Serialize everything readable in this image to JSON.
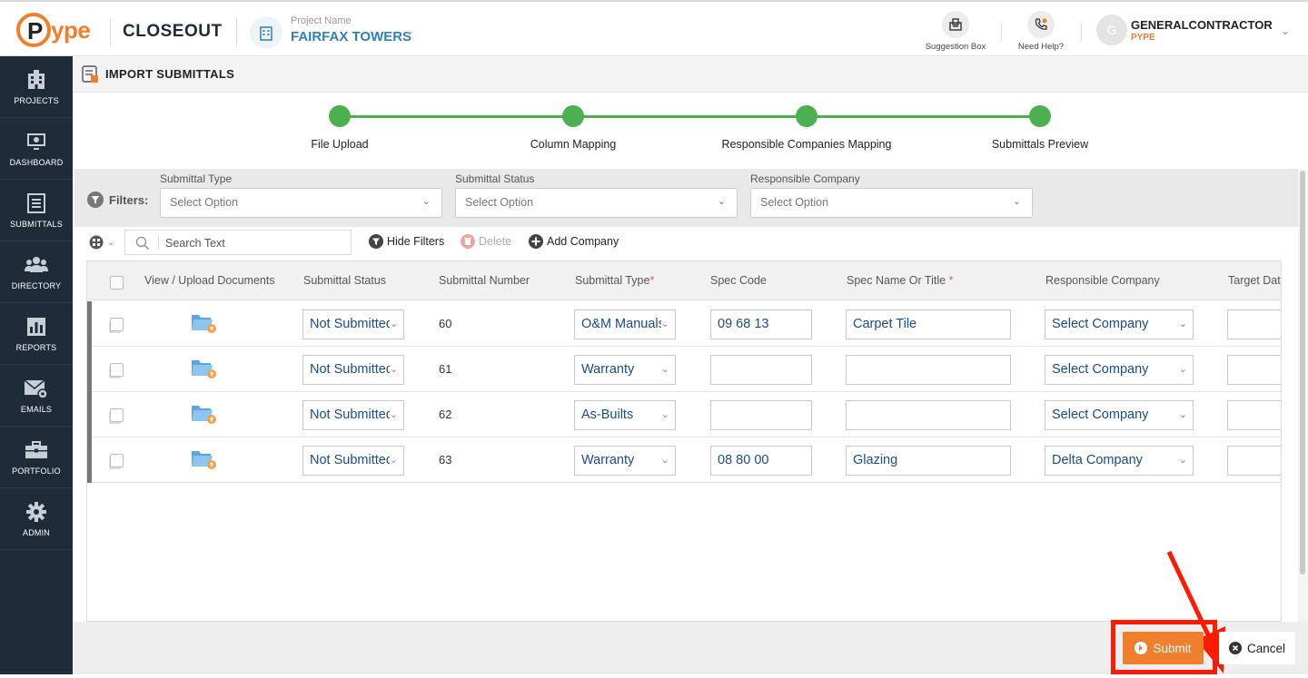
{
  "app": {
    "logo_text": "ype",
    "logo_letter": "P",
    "product_name": "CLOSEOUT",
    "project_label": "Project Name",
    "project_name": "FAIRFAX TOWERS"
  },
  "header": {
    "suggestion_label": "Suggestion Box",
    "help_label": "Need Help?",
    "user_initial": "G",
    "user_name": "GENERALCONTRACTOR",
    "user_org": "PYPE"
  },
  "sidebar": {
    "items": [
      {
        "label": "PROJECTS",
        "icon": "building-icon"
      },
      {
        "label": "DASHBOARD",
        "icon": "monitor-icon"
      },
      {
        "label": "SUBMITTALS",
        "icon": "list-icon"
      },
      {
        "label": "DIRECTORY",
        "icon": "people-icon"
      },
      {
        "label": "REPORTS",
        "icon": "report-icon"
      },
      {
        "label": "EMAILS",
        "icon": "email-icon"
      },
      {
        "label": "PORTFOLIO",
        "icon": "briefcase-icon"
      },
      {
        "label": "ADMIN",
        "icon": "gear-icon"
      }
    ]
  },
  "page": {
    "title": "IMPORT SUBMITTALS"
  },
  "stepper": {
    "steps": [
      "File Upload",
      "Column Mapping",
      "Responsible Companies Mapping",
      "Submittals Preview"
    ],
    "color": "#4caf50"
  },
  "filters": {
    "label": "Filters:",
    "groups": [
      {
        "label": "Submittal Type",
        "value": "Select Option"
      },
      {
        "label": "Submittal Status",
        "value": "Select Option"
      },
      {
        "label": "Responsible Company",
        "value": "Select Option"
      }
    ]
  },
  "toolbar": {
    "search_placeholder": "Search Text",
    "hide_filters": "Hide Filters",
    "delete": "Delete",
    "add_company": "Add Company"
  },
  "table": {
    "columns": [
      "View / Upload Documents",
      "Submittal Status",
      "Submittal Number",
      "Submittal Type",
      "Spec Code",
      "Spec Name Or Title",
      "Responsible Company",
      "Target Dat"
    ],
    "required_marker": "*",
    "rows": [
      {
        "status": "Not Submitted",
        "number": "60",
        "type": "O&M Manuals",
        "spec_code": "09 68 13",
        "spec_name": "Carpet Tile",
        "company": "Select Company"
      },
      {
        "status": "Not Submitted",
        "number": "61",
        "type": "Warranty",
        "spec_code": "",
        "spec_name": "",
        "company": "Select Company"
      },
      {
        "status": "Not Submitted",
        "number": "62",
        "type": "As-Builts",
        "spec_code": "",
        "spec_name": "",
        "company": "Select Company"
      },
      {
        "status": "Not Submitted",
        "number": "63",
        "type": "Warranty",
        "spec_code": "08 80 00",
        "spec_name": "Glazing",
        "company": "Delta Company"
      }
    ]
  },
  "footer": {
    "submit": "Submit",
    "cancel": "Cancel",
    "accent": "#ef7e2d",
    "highlight": "#ff1a00"
  }
}
